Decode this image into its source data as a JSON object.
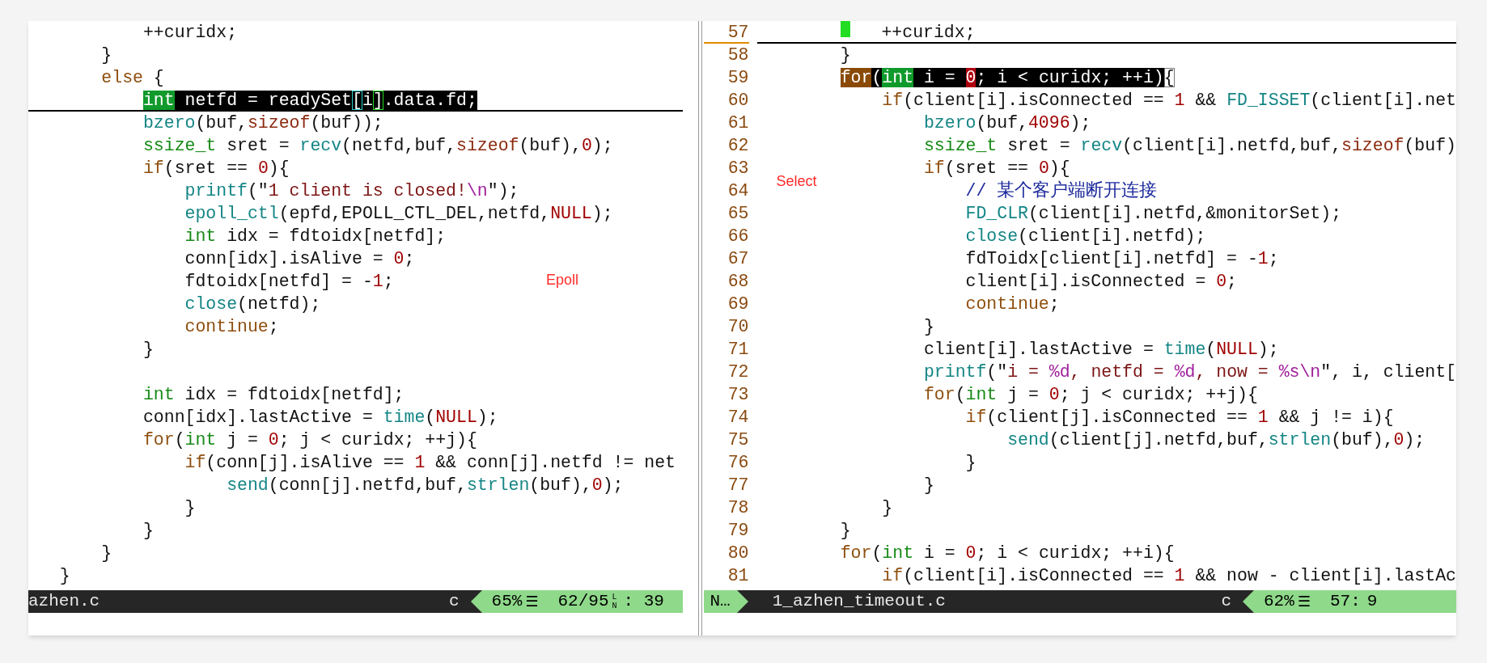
{
  "left_pane": {
    "annotation": "Epoll",
    "lines": [
      {
        "segments": [
          {
            "text": "           ++curidx;"
          }
        ]
      },
      {
        "segments": [
          {
            "text": "       }"
          }
        ]
      },
      {
        "segments": [
          {
            "text": "       else",
            "kind": "keyword"
          },
          {
            "text": " {"
          }
        ]
      },
      {
        "cursorline": true,
        "segments": [
          {
            "text": "           int",
            "kind": "type-match"
          },
          {
            "text": " netfd = readySet",
            "kind": "selection"
          },
          {
            "text": "[",
            "kind": "bracket-open"
          },
          {
            "text": "i",
            "kind": "selection"
          },
          {
            "text": "]",
            "kind": "bracket-close"
          },
          {
            "text": ".data.fd;",
            "kind": "selection"
          }
        ]
      },
      {
        "segments": [
          {
            "text": "           bzero",
            "kind": "function"
          },
          {
            "text": "(buf,"
          },
          {
            "text": "sizeof",
            "kind": "operator"
          },
          {
            "text": "(buf));"
          }
        ]
      },
      {
        "segments": [
          {
            "text": "           ssize_t",
            "kind": "type"
          },
          {
            "text": " sret = "
          },
          {
            "text": "recv",
            "kind": "function"
          },
          {
            "text": "(netfd,buf,"
          },
          {
            "text": "sizeof",
            "kind": "operator"
          },
          {
            "text": "(buf),"
          },
          {
            "text": "0",
            "kind": "number"
          },
          {
            "text": ");"
          }
        ]
      },
      {
        "segments": [
          {
            "text": "           if",
            "kind": "keyword"
          },
          {
            "text": "(sret == "
          },
          {
            "text": "0",
            "kind": "number"
          },
          {
            "text": "){"
          }
        ]
      },
      {
        "segments": [
          {
            "text": "               printf",
            "kind": "function"
          },
          {
            "text": "(\""
          },
          {
            "text": "1 client is closed!",
            "kind": "string"
          },
          {
            "text": "\\n",
            "kind": "escape"
          },
          {
            "text": "\");"
          }
        ]
      },
      {
        "segments": [
          {
            "text": "               epoll_ctl",
            "kind": "function"
          },
          {
            "text": "(epfd,EPOLL_CTL_DEL,netfd,"
          },
          {
            "text": "NULL",
            "kind": "constant"
          },
          {
            "text": ");"
          }
        ]
      },
      {
        "segments": [
          {
            "text": "               int",
            "kind": "type"
          },
          {
            "text": " idx = fdtoidx[netfd];"
          }
        ]
      },
      {
        "segments": [
          {
            "text": "               conn[idx].isAlive = "
          },
          {
            "text": "0",
            "kind": "number"
          },
          {
            "text": ";"
          }
        ]
      },
      {
        "segments": [
          {
            "text": "               fdtoidx[netfd] = -"
          },
          {
            "text": "1",
            "kind": "number"
          },
          {
            "text": ";"
          }
        ]
      },
      {
        "segments": [
          {
            "text": "               close",
            "kind": "function"
          },
          {
            "text": "(netfd);"
          }
        ]
      },
      {
        "segments": [
          {
            "text": "               continue",
            "kind": "keyword"
          },
          {
            "text": ";"
          }
        ]
      },
      {
        "segments": [
          {
            "text": "           }"
          }
        ]
      },
      {
        "kind": "blank"
      },
      {
        "segments": [
          {
            "text": "           int",
            "kind": "type"
          },
          {
            "text": " idx = fdtoidx[netfd];"
          }
        ]
      },
      {
        "segments": [
          {
            "text": "           conn[idx].lastActive = "
          },
          {
            "text": "time",
            "kind": "function"
          },
          {
            "text": "("
          },
          {
            "text": "NULL",
            "kind": "constant"
          },
          {
            "text": ");"
          }
        ]
      },
      {
        "segments": [
          {
            "text": "           for",
            "kind": "keyword"
          },
          {
            "text": "("
          },
          {
            "text": "int",
            "kind": "type"
          },
          {
            "text": " j = "
          },
          {
            "text": "0",
            "kind": "number"
          },
          {
            "text": "; j < curidx; ++j){"
          }
        ]
      },
      {
        "segments": [
          {
            "text": "               if",
            "kind": "keyword"
          },
          {
            "text": "(conn[j].isAlive == "
          },
          {
            "text": "1",
            "kind": "number"
          },
          {
            "text": " && conn[j].netfd != net"
          }
        ]
      },
      {
        "segments": [
          {
            "text": "                   send",
            "kind": "function"
          },
          {
            "text": "(conn[j].netfd,buf,"
          },
          {
            "text": "strlen",
            "kind": "function"
          },
          {
            "text": "(buf),"
          },
          {
            "text": "0",
            "kind": "number"
          },
          {
            "text": ");"
          }
        ]
      },
      {
        "segments": [
          {
            "text": "               }"
          }
        ]
      },
      {
        "segments": [
          {
            "text": "           }"
          }
        ]
      },
      {
        "segments": [
          {
            "text": "       }"
          }
        ]
      },
      {
        "segments": [
          {
            "text": "   }"
          }
        ]
      }
    ],
    "status_bar": {
      "file": "azhen.c",
      "filetype": "c",
      "percent": "65%",
      "menu_glyph": "☰",
      "line": "62/95",
      "maxline_glyph": [
        "L",
        "N"
      ],
      "column": ": 39"
    }
  },
  "right_pane": {
    "annotation": "Select",
    "lines": [
      {
        "number": "57",
        "cursorline": true,
        "cursor": true,
        "segments": [
          {
            "text": "            ++curidx;"
          }
        ]
      },
      {
        "number": "58",
        "segments": [
          {
            "text": "        }"
          }
        ]
      },
      {
        "number": "59",
        "segments": [
          {
            "text": "        for",
            "kind": "keyword-match"
          },
          {
            "text": "(",
            "kind": "selection"
          },
          {
            "text": "int",
            "kind": "type-match"
          },
          {
            "text": " i = ",
            "kind": "selection"
          },
          {
            "text": "0",
            "kind": "number-match"
          },
          {
            "text": "; i < curidx; ++i)",
            "kind": "selection"
          },
          {
            "text": "{",
            "kind": "cursor-outline"
          }
        ]
      },
      {
        "number": "60",
        "segments": [
          {
            "text": "            if",
            "kind": "keyword"
          },
          {
            "text": "(client[i].isConnected == "
          },
          {
            "text": "1",
            "kind": "number"
          },
          {
            "text": " && "
          },
          {
            "text": "FD_ISSET",
            "kind": "function"
          },
          {
            "text": "(client[i].net"
          }
        ]
      },
      {
        "number": "61",
        "segments": [
          {
            "text": "                bzero",
            "kind": "function"
          },
          {
            "text": "(buf,"
          },
          {
            "text": "4096",
            "kind": "number"
          },
          {
            "text": ");"
          }
        ]
      },
      {
        "number": "62",
        "segments": [
          {
            "text": "                ssize_t",
            "kind": "type"
          },
          {
            "text": " sret = "
          },
          {
            "text": "recv",
            "kind": "function"
          },
          {
            "text": "(client[i].netfd,buf,"
          },
          {
            "text": "sizeof",
            "kind": "operator"
          },
          {
            "text": "(buf)"
          }
        ]
      },
      {
        "number": "63",
        "segments": [
          {
            "text": "                if",
            "kind": "keyword"
          },
          {
            "text": "(sret == "
          },
          {
            "text": "0",
            "kind": "number"
          },
          {
            "text": "){"
          }
        ]
      },
      {
        "number": "64",
        "segments": [
          {
            "text": "                    // 某个客户端断开连接",
            "kind": "comment"
          }
        ]
      },
      {
        "number": "65",
        "segments": [
          {
            "text": "                    FD_CLR",
            "kind": "function"
          },
          {
            "text": "(client[i].netfd,&monitorSet);"
          }
        ]
      },
      {
        "number": "66",
        "segments": [
          {
            "text": "                    close",
            "kind": "function"
          },
          {
            "text": "(client[i].netfd);"
          }
        ]
      },
      {
        "number": "67",
        "segments": [
          {
            "text": "                    fdToidx[client[i].netfd] = -"
          },
          {
            "text": "1",
            "kind": "number"
          },
          {
            "text": ";"
          }
        ]
      },
      {
        "number": "68",
        "segments": [
          {
            "text": "                    client[i].isConnected = "
          },
          {
            "text": "0",
            "kind": "number"
          },
          {
            "text": ";"
          }
        ]
      },
      {
        "number": "69",
        "segments": [
          {
            "text": "                    continue",
            "kind": "keyword"
          },
          {
            "text": ";"
          }
        ]
      },
      {
        "number": "70",
        "segments": [
          {
            "text": "                }"
          }
        ]
      },
      {
        "number": "71",
        "segments": [
          {
            "text": "                client[i].lastActive = "
          },
          {
            "text": "time",
            "kind": "function"
          },
          {
            "text": "("
          },
          {
            "text": "NULL",
            "kind": "constant"
          },
          {
            "text": ");"
          }
        ]
      },
      {
        "number": "72",
        "segments": [
          {
            "text": "                printf",
            "kind": "function"
          },
          {
            "text": "(\""
          },
          {
            "text": "i = ",
            "kind": "string"
          },
          {
            "text": "%d",
            "kind": "escape"
          },
          {
            "text": ", netfd = ",
            "kind": "string"
          },
          {
            "text": "%d",
            "kind": "escape"
          },
          {
            "text": ", now = ",
            "kind": "string"
          },
          {
            "text": "%s\\n",
            "kind": "escape"
          },
          {
            "text": "\", i, client["
          }
        ]
      },
      {
        "number": "73",
        "segments": [
          {
            "text": "                for",
            "kind": "keyword"
          },
          {
            "text": "("
          },
          {
            "text": "int",
            "kind": "type"
          },
          {
            "text": " j = "
          },
          {
            "text": "0",
            "kind": "number"
          },
          {
            "text": "; j < curidx; ++j){"
          }
        ]
      },
      {
        "number": "74",
        "segments": [
          {
            "text": "                    if",
            "kind": "keyword"
          },
          {
            "text": "(client[j].isConnected == "
          },
          {
            "text": "1",
            "kind": "number"
          },
          {
            "text": " && j != i){"
          }
        ]
      },
      {
        "number": "75",
        "segments": [
          {
            "text": "                        send",
            "kind": "function"
          },
          {
            "text": "(client[j].netfd,buf,"
          },
          {
            "text": "strlen",
            "kind": "function"
          },
          {
            "text": "(buf),"
          },
          {
            "text": "0",
            "kind": "number"
          },
          {
            "text": ");"
          }
        ]
      },
      {
        "number": "76",
        "segments": [
          {
            "text": "                    }"
          }
        ]
      },
      {
        "number": "77",
        "segments": [
          {
            "text": "                }"
          }
        ]
      },
      {
        "number": "78",
        "segments": [
          {
            "text": "            }"
          }
        ]
      },
      {
        "number": "79",
        "segments": [
          {
            "text": "        }"
          }
        ]
      },
      {
        "number": "80",
        "segments": [
          {
            "text": "        for",
            "kind": "keyword"
          },
          {
            "text": "("
          },
          {
            "text": "int",
            "kind": "type"
          },
          {
            "text": " i = "
          },
          {
            "text": "0",
            "kind": "number"
          },
          {
            "text": "; i < curidx; ++i){"
          }
        ]
      },
      {
        "number": "81",
        "segments": [
          {
            "text": "            if",
            "kind": "keyword"
          },
          {
            "text": "(client[i].isConnected == "
          },
          {
            "text": "1",
            "kind": "number"
          },
          {
            "text": " && now - client[i].lastAc"
          }
        ]
      }
    ],
    "status_bar": {
      "mode": "N…",
      "file": "1_azhen_timeout.c",
      "filetype": "c",
      "percent": "62%",
      "menu_glyph": "☰",
      "line": "57:",
      "column": "9"
    }
  }
}
